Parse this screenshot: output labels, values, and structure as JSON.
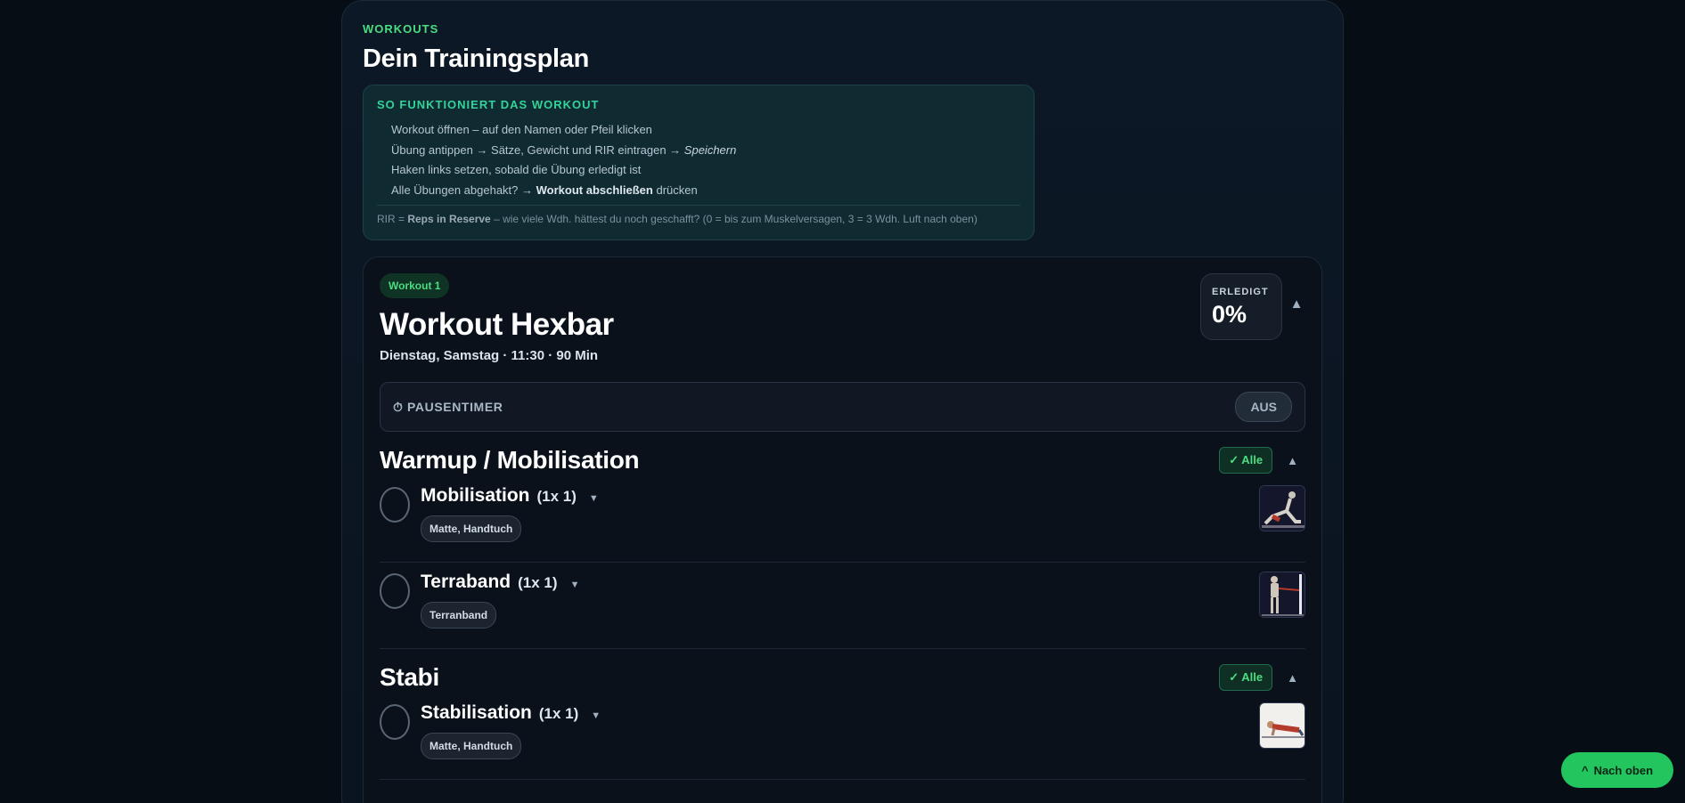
{
  "header": {
    "eyebrow": "WORKOUTS",
    "title": "Dein Trainingsplan"
  },
  "info": {
    "title": "SO FUNKTIONIERT DAS WORKOUT",
    "steps": [
      {
        "text": "Workout öffnen – auf den Namen oder Pfeil klicken"
      },
      {
        "pre": "Übung antippen → Sätze, Gewicht und RIR eintragen → ",
        "em": "Speichern"
      },
      {
        "text": "Haken links setzen, sobald die Übung erledigt ist"
      },
      {
        "pre": "Alle Übungen abgehakt? → ",
        "strong": "Workout abschließen",
        "post": " drücken"
      }
    ],
    "rir": {
      "pre": "RIR = ",
      "strong": "Reps in Reserve",
      "post": " – wie viele Wdh. hättest du noch geschafft? (0 = bis zum Muskelversagen, 3 = 3 Wdh. Luft nach oben)"
    }
  },
  "workout": {
    "badge": "Workout 1",
    "title": "Workout Hexbar",
    "subtitle": "Dienstag, Samstag · 11:30 · 90 Min",
    "done_label": "ERLEDIGT",
    "done_value": "0%",
    "collapse_icon": "▲",
    "timer_label": "⏱ PAUSENTIMER",
    "timer_toggle": "AUS"
  },
  "sections": [
    {
      "title": "Warmup / Mobilisation",
      "all_label": "✓ Alle",
      "toggle": "▲",
      "exercises": [
        {
          "name": "Mobilisation",
          "sets": "(1x 1)",
          "caret": "▼",
          "equipment": "Matte, Handtuch"
        },
        {
          "name": "Terraband",
          "sets": "(1x 1)",
          "caret": "▼",
          "equipment": "Terranband"
        }
      ]
    },
    {
      "title": "Stabi",
      "all_label": "✓ Alle",
      "toggle": "▲",
      "exercises": [
        {
          "name": "Stabilisation",
          "sets": "(1x 1)",
          "caret": "▼",
          "equipment": "Matte, Handtuch"
        }
      ]
    }
  ],
  "scroll_top": {
    "icon": "^",
    "label": "Nach oben"
  },
  "colors": {
    "accent": "#4ade80",
    "button_green": "#22c55e",
    "background": "#070d15"
  }
}
